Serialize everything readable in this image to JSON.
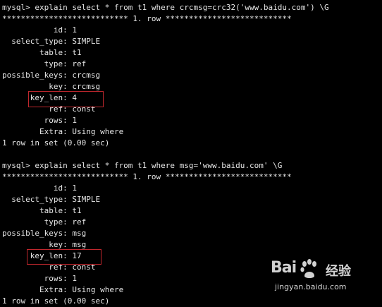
{
  "terminal": {
    "query1": {
      "lines": [
        "mysql> explain select * from t1 where crcmsg=crc32('www.baidu.com') \\G",
        "*************************** 1. row ***************************",
        "           id: 1",
        "  select_type: SIMPLE",
        "        table: t1",
        "         type: ref",
        "possible_keys: crcmsg",
        "          key: crcmsg",
        "      key_len: 4",
        "          ref: const",
        "         rows: 1",
        "        Extra: Using where",
        "1 row in set (0.00 sec)"
      ]
    },
    "query2": {
      "lines": [
        "mysql> explain select * from t1 where msg='www.baidu.com' \\G",
        "*************************** 1. row ***************************",
        "           id: 1",
        "  select_type: SIMPLE",
        "        table: t1",
        "         type: ref",
        "possible_keys: msg",
        "          key: msg",
        "      key_len: 17",
        "          ref: const",
        "         rows: 1",
        "        Extra: Using where",
        "1 row in set (0.00 sec)"
      ]
    }
  },
  "watermark": {
    "logo_text": "Bai",
    "logo_suffix": "经验",
    "url": "jingyan.baidu.com"
  },
  "colors": {
    "background": "#000000",
    "text": "#e6e6e6",
    "highlight_box": "#c0272d"
  }
}
